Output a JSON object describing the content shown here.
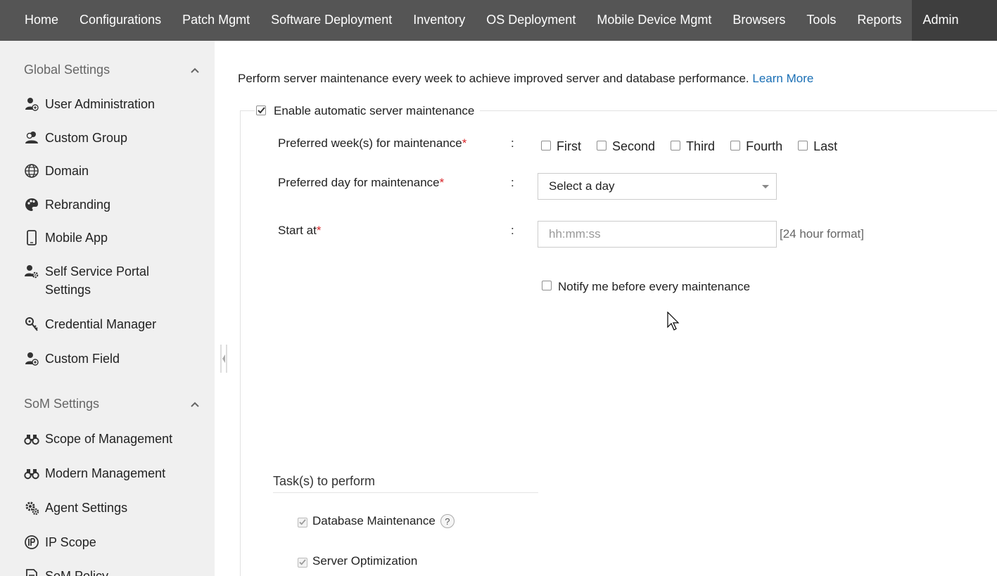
{
  "topnav": {
    "items": [
      "Home",
      "Configurations",
      "Patch Mgmt",
      "Software Deployment",
      "Inventory",
      "OS Deployment",
      "Mobile Device Mgmt",
      "Browsers",
      "Tools",
      "Reports",
      "Admin"
    ],
    "active": "Admin"
  },
  "sidebar": {
    "global_settings": {
      "title": "Global Settings",
      "items": [
        "User Administration",
        "Custom Group",
        "Domain",
        "Rebranding",
        "Mobile App",
        "Self Service Portal Settings",
        "Credential Manager",
        "Custom Field"
      ],
      "icons": [
        "user-add-icon",
        "user-group-icon",
        "globe-icon",
        "palette-icon",
        "mobile-phone-icon",
        "user-gear-icon",
        "key-icon",
        "user-add-icon"
      ]
    },
    "som_settings": {
      "title": "SoM Settings",
      "items": [
        "Scope of Management",
        "Modern Management",
        "Agent Settings",
        "IP Scope",
        "SoM Policy"
      ],
      "icons": [
        "binoculars-icon",
        "binoculars-icon",
        "gears-icon",
        "ip-globe-icon",
        "policy-icon"
      ]
    }
  },
  "main": {
    "intro_text": "Perform server maintenance every week to achieve improved server and database performance.",
    "learn_more": "Learn More",
    "enable_label": "Enable automatic server maintenance",
    "enable_checked": true,
    "weeks_label": "Preferred week(s) for maintenance",
    "weeks": [
      "First",
      "Second",
      "Third",
      "Fourth",
      "Last"
    ],
    "day_label": "Preferred day for maintenance",
    "day_select_value": "Select a day",
    "start_label": "Start at",
    "start_placeholder": "hh:mm:ss",
    "start_hint": "[24 hour format]",
    "required_mark": "*",
    "colon": ":",
    "notify_label": "Notify me before every maintenance",
    "tasks_title": "Task(s) to perform",
    "tasks": [
      "Database Maintenance",
      "Server Optimization"
    ],
    "help_glyph": "?"
  },
  "colors": {
    "topnav_bg": "#555555",
    "topnav_active": "#3e3e3e",
    "sidebar_bg": "#f0f0f0",
    "link": "#1a6fb5",
    "required": "#d9262a"
  }
}
